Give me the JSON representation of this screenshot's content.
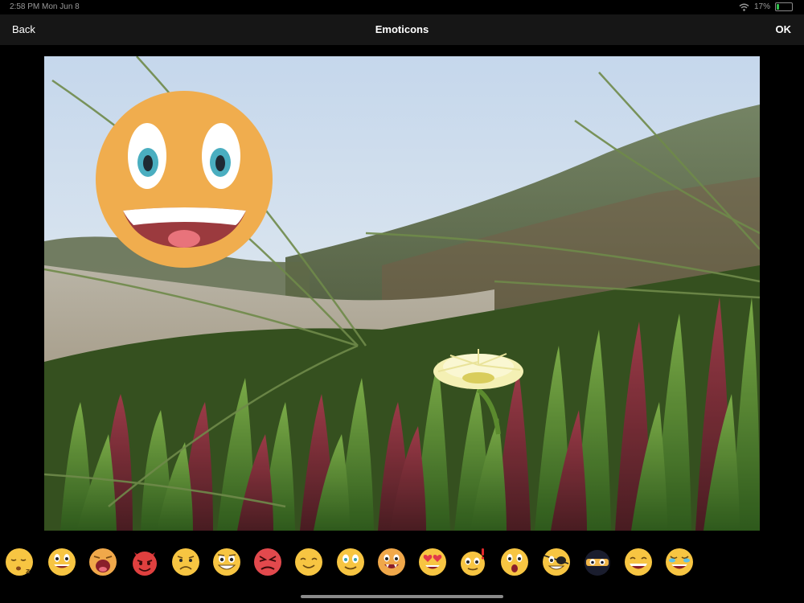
{
  "status_bar": {
    "time": "2:58 PM  Mon Jun 8",
    "battery": "17%",
    "battery_level": 0.17
  },
  "nav": {
    "back_label": "Back",
    "title": "Emoticons",
    "ok_label": "OK"
  },
  "colors": {
    "emoji_yellow": "#f7c542",
    "big_emoji": "#f0ad4e",
    "nav_bg": "#161616"
  },
  "canvas": {
    "photo": "dune-plants-photo",
    "sticker": "big-grin-emoji"
  },
  "tray": {
    "items": [
      {
        "name": "sleeping-emoji-icon"
      },
      {
        "name": "smiling-emoji-icon"
      },
      {
        "name": "shocked-emoji-icon"
      },
      {
        "name": "devil-emoji-icon"
      },
      {
        "name": "frowning-emoji-icon"
      },
      {
        "name": "grinning-emoji-icon"
      },
      {
        "name": "angry-emoji-icon"
      },
      {
        "name": "content-emoji-icon"
      },
      {
        "name": "smiling-eyes-emoji-icon"
      },
      {
        "name": "fanged-emoji-icon"
      },
      {
        "name": "heart-eyes-emoji-icon"
      },
      {
        "name": "exclaiming-emoji-icon"
      },
      {
        "name": "surprised-emoji-icon"
      },
      {
        "name": "eyepatch-emoji-icon"
      },
      {
        "name": "ninja-emoji-icon"
      },
      {
        "name": "big-smile-emoji-icon"
      },
      {
        "name": "laughing-tears-emoji-icon"
      }
    ]
  }
}
